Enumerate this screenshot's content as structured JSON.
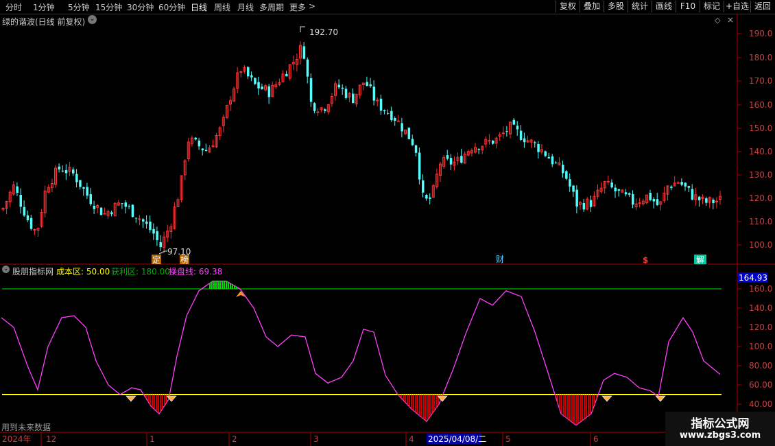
{
  "toolbar": {
    "periods": [
      "分时",
      "1分钟",
      "5分钟",
      "15分钟",
      "30分钟",
      "60分钟",
      "日线",
      "周线",
      "月线",
      "多周期",
      "更多"
    ],
    "active": "日线",
    "more_arrow": ">",
    "right_buttons": [
      "复权",
      "叠加",
      "多股",
      "统计",
      "画线",
      "F10",
      "标记",
      "+自选",
      "返回"
    ]
  },
  "main_title": "绿的谐波(日线 前复权)",
  "main_title_toggle": "⌄",
  "price_axis": [
    "190.0",
    "180.0",
    "170.0",
    "160.0",
    "150.0",
    "140.0",
    "130.0",
    "120.0",
    "110.0",
    "100.0"
  ],
  "annotations": {
    "high": "192.70",
    "low": "97.10"
  },
  "event_markers": [
    "定",
    "榜",
    "财",
    "$",
    "解"
  ],
  "indicator": {
    "name": "股朋指标网",
    "cost_label": "成本区: 50.00",
    "profit_label": "获利区: 180.00",
    "line_label": "操盘线: 69.38",
    "current_value": "164.93",
    "axis": [
      "160.0",
      "140.0",
      "120.0",
      "100.0",
      "80.00",
      "60.00",
      "40.00"
    ]
  },
  "footnote": "用到未来数据",
  "timeline": {
    "year_label": "2024年",
    "months": [
      "12",
      "1",
      "2",
      "3",
      "4",
      "5",
      "6"
    ],
    "cursor_date": "2025/04/08/二"
  },
  "watermark": {
    "title": "指标公式网",
    "url": "www.zbgs3.com"
  },
  "colors": {
    "up": "#ff3232",
    "down": "#54fcfc",
    "line": "#ff40ff",
    "cost": "#ffff00",
    "profit": "#00a000",
    "axis": "#b00000"
  }
}
